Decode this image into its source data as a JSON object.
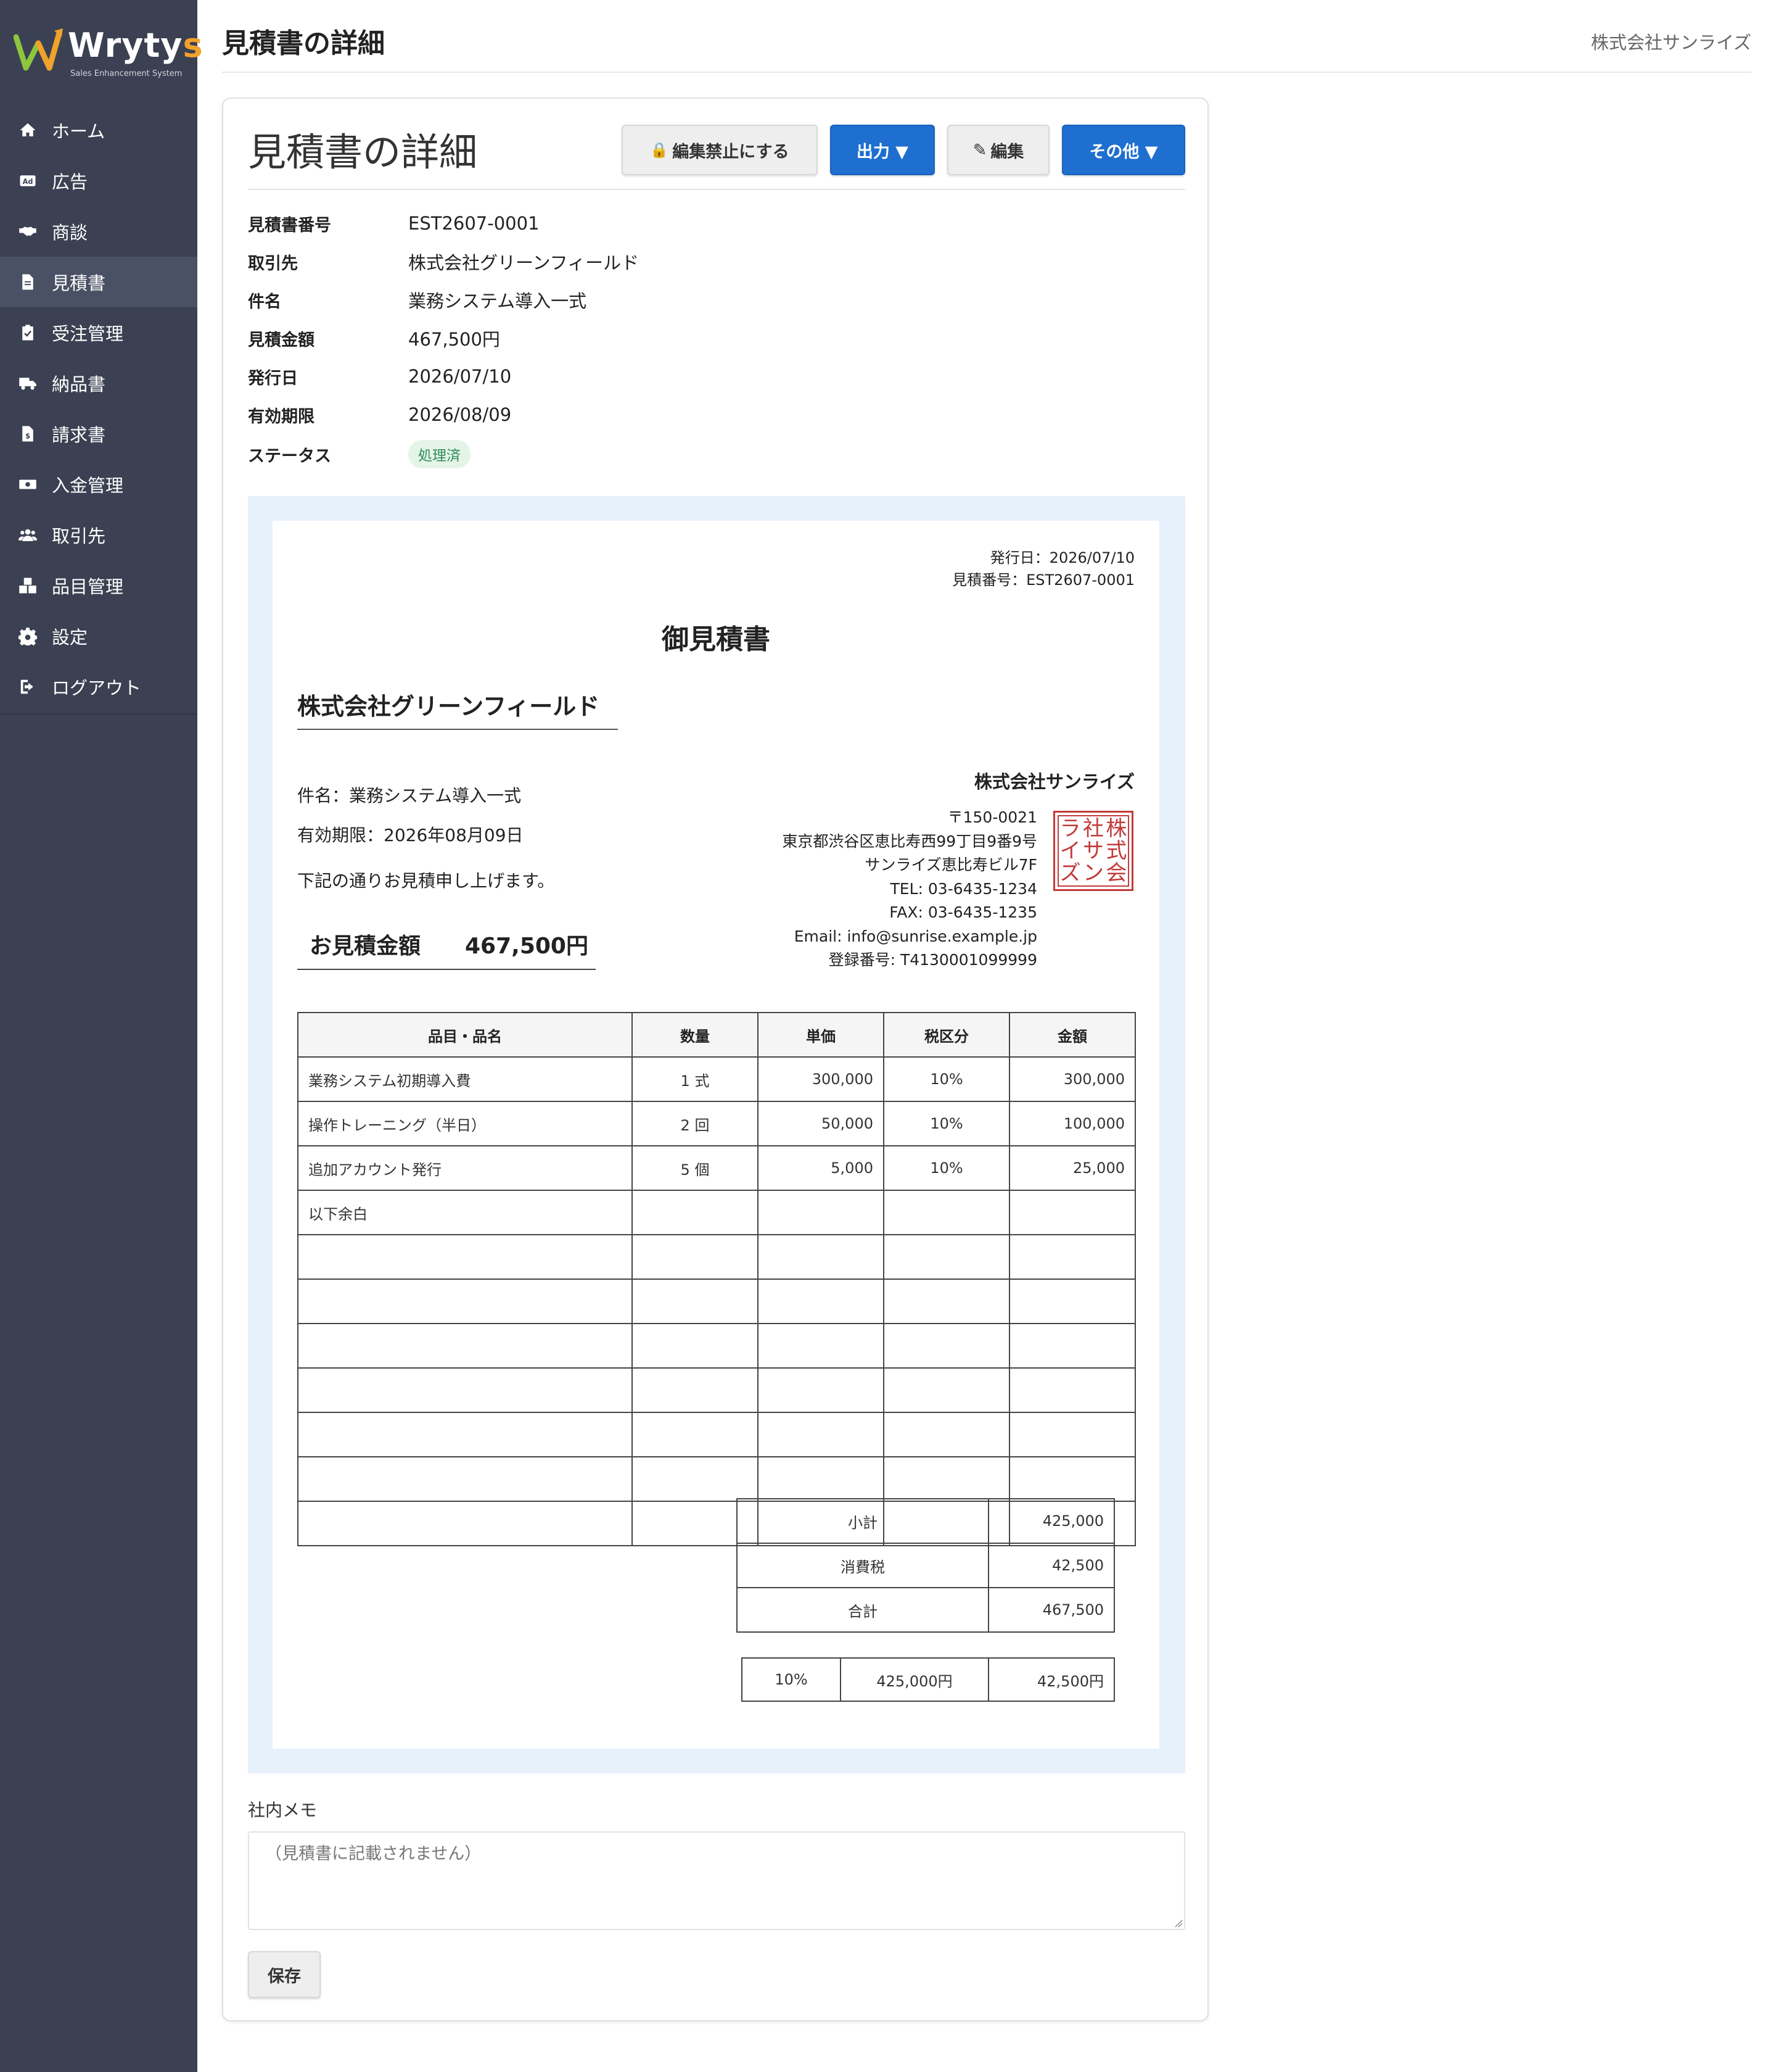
{
  "app": {
    "logo_prefix": "Wryty",
    "logo_suffix": "s",
    "logo_subtitle": "Sales Enhancement System",
    "brand_accent": "#f0a22a",
    "sidebar_color": "#3b4152"
  },
  "sidebar": {
    "items": [
      {
        "label": "ホーム",
        "icon": "home-icon"
      },
      {
        "label": "広告",
        "icon": "ad-icon"
      },
      {
        "label": "商談",
        "icon": "handshake-icon"
      },
      {
        "label": "見積書",
        "icon": "document-icon",
        "active": true
      },
      {
        "label": "受注管理",
        "icon": "clipboard-check-icon"
      },
      {
        "label": "納品書",
        "icon": "truck-icon"
      },
      {
        "label": "請求書",
        "icon": "invoice-icon"
      },
      {
        "label": "入金管理",
        "icon": "money-icon"
      },
      {
        "label": "取引先",
        "icon": "users-icon"
      },
      {
        "label": "品目管理",
        "icon": "boxes-icon"
      },
      {
        "label": "設定",
        "icon": "gear-icon"
      },
      {
        "label": "ログアウト",
        "icon": "logout-icon"
      }
    ]
  },
  "header": {
    "title": "見積書の詳細",
    "company": "株式会社サンライズ"
  },
  "card": {
    "title": "見積書の詳細",
    "buttons": {
      "lock": "編集禁止にする",
      "lock_icon": "🔒",
      "export": "出力 ▼",
      "edit": "編集",
      "edit_icon": "✎",
      "more": "その他 ▼"
    },
    "info": [
      {
        "label": "見積書番号",
        "value": "EST2607-0001"
      },
      {
        "label": "取引先",
        "value": "株式会社グリーンフィールド"
      },
      {
        "label": "件名",
        "value": "業務システム導入一式"
      },
      {
        "label": "見積金額",
        "value": "467,500円"
      },
      {
        "label": "発行日",
        "value": "2026/07/10"
      },
      {
        "label": "有効期限",
        "value": "2026/08/09"
      },
      {
        "label": "ステータス",
        "value": "処理済"
      }
    ]
  },
  "document": {
    "issue_date": "発行日：2026/07/10",
    "estimate_no": "見積番号：EST2607-0001",
    "title": "御見積書",
    "client": "株式会社グリーンフィールド",
    "subject": "件名：業務システム導入一式",
    "valid_until": "有効期限：2026年08月09日",
    "greeting": "下記の通りお見積申し上げます。",
    "total_label": "お見積金額",
    "total_value": "467,500円",
    "issuer": {
      "name": "株式会社サンライズ",
      "postal": "〒150-0021",
      "address1": "東京都渋谷区恵比寿西99丁目9番9号",
      "address2": "サンライズ恵比寿ビル7F",
      "tel": "TEL: 03-6435-1234",
      "fax": "FAX: 03-6435-1235",
      "email": "Email: info@sunrise.example.jp",
      "reg_no": "登録番号: T4130001099999",
      "stamp_text": "株式会社サンライズ"
    },
    "table_headers": [
      "品目・品名",
      "数量",
      "単価",
      "税区分",
      "金額"
    ],
    "rows": [
      {
        "name": "業務システム初期導入費",
        "qty": "1 式",
        "unit": "300,000",
        "tax": "10%",
        "amount": "300,000"
      },
      {
        "name": "操作トレーニング（半日）",
        "qty": "2 回",
        "unit": "50,000",
        "tax": "10%",
        "amount": "100,000"
      },
      {
        "name": "追加アカウント発行",
        "qty": "5 個",
        "unit": "5,000",
        "tax": "10%",
        "amount": "25,000"
      },
      {
        "name": "以下余白",
        "qty": "",
        "unit": "",
        "tax": "",
        "amount": ""
      }
    ],
    "empty_rows": 7,
    "summary": [
      {
        "label": "小計",
        "value": "425,000"
      },
      {
        "label": "消費税",
        "value": "42,500"
      },
      {
        "label": "合計",
        "value": "467,500"
      }
    ],
    "tax_breakdown": {
      "rate": "10%",
      "base": "425,000円",
      "tax": "42,500円"
    }
  },
  "memo": {
    "label": "社内メモ",
    "placeholder": "（見積書に記載されません）",
    "save_label": "保存"
  }
}
